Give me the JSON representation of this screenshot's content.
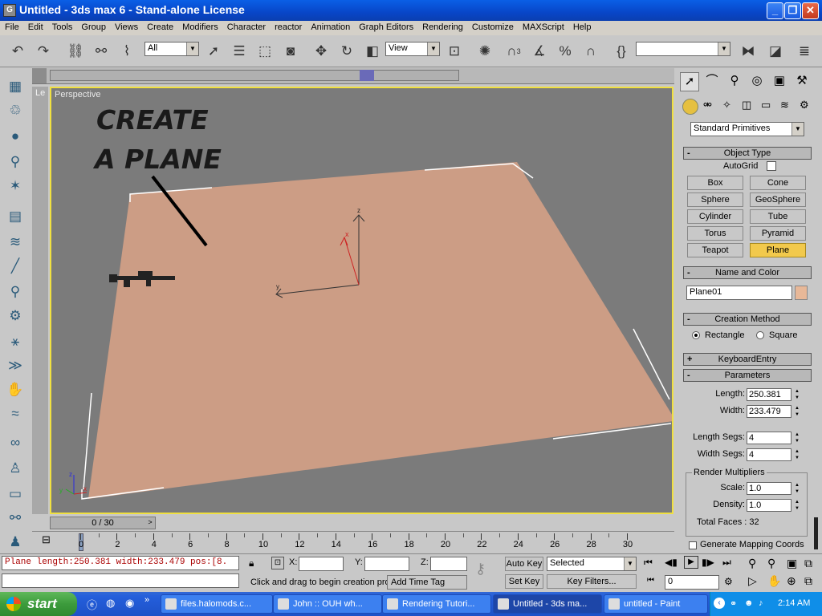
{
  "window": {
    "app_icon": "3dsmax-app-icon",
    "title": "Untitled - 3ds max 6 - Stand-alone License",
    "min_label": "_",
    "max_label": "❐",
    "close_label": "✕"
  },
  "menu": [
    "File",
    "Edit",
    "Tools",
    "Group",
    "Views",
    "Create",
    "Modifiers",
    "Character",
    "reactor",
    "Animation",
    "Graph Editors",
    "Rendering",
    "Customize",
    "MAXScript",
    "Help"
  ],
  "toolbar": {
    "selection_filter": "All",
    "reference_coord": "View",
    "named_selection": "",
    "snap_3_label": "3"
  },
  "viewport": {
    "label": "Perspective",
    "top_left_label": "Le",
    "overlay_line1": "CREATE",
    "overlay_line2": "A PLANE",
    "axis_x": "x",
    "axis_y": "y",
    "axis_z": "z",
    "plane_color": "#cc9d85",
    "border_color": "#f0e040"
  },
  "command_panel": {
    "category": "Standard Primitives",
    "object_type_title": "Object Type",
    "autogrid_label": "AutoGrid",
    "buttons": [
      {
        "label": "Box",
        "active": false
      },
      {
        "label": "Cone",
        "active": false
      },
      {
        "label": "Sphere",
        "active": false
      },
      {
        "label": "GeoSphere",
        "active": false
      },
      {
        "label": "Cylinder",
        "active": false
      },
      {
        "label": "Tube",
        "active": false
      },
      {
        "label": "Torus",
        "active": false
      },
      {
        "label": "Pyramid",
        "active": false
      },
      {
        "label": "Teapot",
        "active": false
      },
      {
        "label": "Plane",
        "active": true
      }
    ],
    "name_color_title": "Name and Color",
    "object_name": "Plane01",
    "object_color": "#e8b898",
    "creation_method_title": "Creation Method",
    "method_rectangle": "Rectangle",
    "method_square": "Square",
    "keyboard_entry_title": "KeyboardEntry",
    "parameters_title": "Parameters",
    "length_label": "Length:",
    "length_value": "250.381",
    "width_label": "Width:",
    "width_value": "233.479",
    "length_segs_label": "Length Segs:",
    "length_segs_value": "4",
    "width_segs_label": "Width Segs:",
    "width_segs_value": "4",
    "render_mult_title": "Render Multipliers",
    "scale_label": "Scale:",
    "scale_value": "1.0",
    "density_label": "Density:",
    "density_value": "1.0",
    "total_faces": "Total Faces : 32",
    "cut_label": "Generate Mapping Coords."
  },
  "timeline": {
    "frame_display": "0 / 30",
    "ticks": [
      "0",
      "2",
      "4",
      "6",
      "8",
      "10",
      "12",
      "14",
      "16",
      "18",
      "20",
      "22",
      "24",
      "26",
      "28",
      "30"
    ]
  },
  "status": {
    "maxscript_line": "Plane length:250.381 width:233.479 pos:[8.",
    "prompt": "Click and drag to begin creation pro",
    "add_time_tag": "Add Time Tag",
    "x_label": "X:",
    "y_label": "Y:",
    "z_label": "Z:",
    "auto_key": "Auto Key",
    "set_key": "Set Key",
    "selected": "Selected",
    "key_filters": "Key Filters...",
    "current_frame": "0"
  },
  "taskbar": {
    "start": "start",
    "tasks": [
      {
        "label": "files.halomods.c...",
        "active": false
      },
      {
        "label": "John :: OUH wh...",
        "active": false
      },
      {
        "label": "Rendering Tutori...",
        "active": false
      },
      {
        "label": "Untitled - 3ds ma...",
        "active": true
      },
      {
        "label": "untitled - Paint",
        "active": false
      }
    ],
    "clock": "2:14 AM"
  }
}
